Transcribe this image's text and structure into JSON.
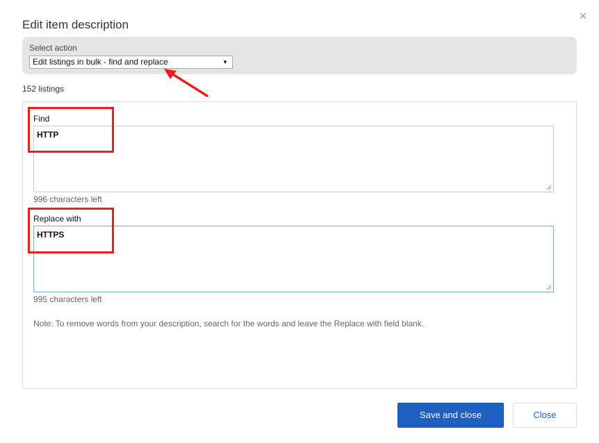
{
  "dialog": {
    "title": "Edit item description",
    "close_glyph": "×"
  },
  "action": {
    "label": "Select action",
    "selected": "Edit listings in bulk - find and replace"
  },
  "listing_count": "152 listings",
  "find": {
    "label": "Find",
    "value": "HTTP",
    "chars_left": "996 characters left"
  },
  "replace": {
    "label": "Replace with",
    "value": "HTTPS",
    "chars_left": "995 characters left"
  },
  "note": "Note: To remove words from your description, search for the words and leave the Replace with field blank.",
  "buttons": {
    "save_label": "Save and close",
    "close_label": "Close"
  },
  "colors": {
    "primary": "#1f5fbf",
    "annotation": "#e8201c",
    "panel_bg": "#e5e5e5"
  },
  "icons": {
    "close": "close-icon",
    "select_caret": "caret-down-icon",
    "resize": "resize-grip-icon"
  }
}
